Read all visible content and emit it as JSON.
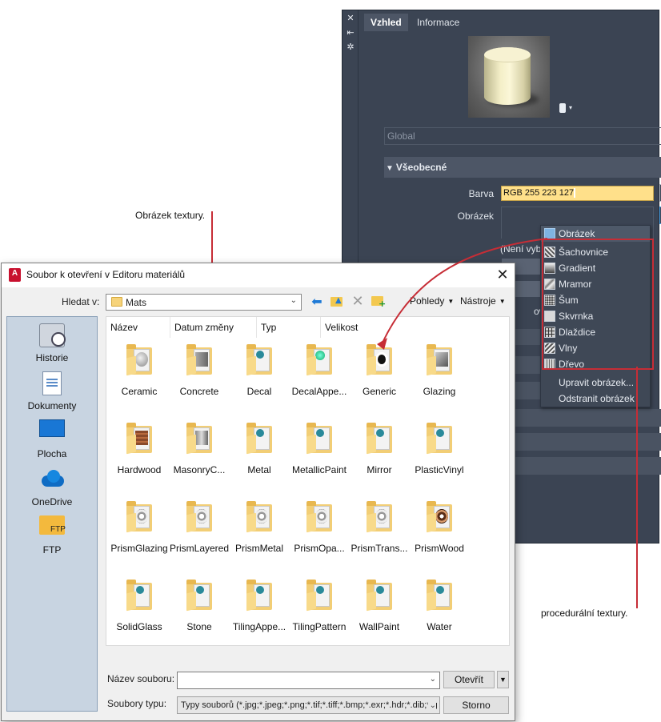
{
  "material_editor": {
    "side_icons": [
      "close-icon",
      "pin-icon",
      "settings-icon"
    ],
    "tabs": [
      {
        "label": "Vzhled",
        "active": true
      },
      {
        "label": "Informace",
        "active": false
      }
    ],
    "global_placeholder": "Global",
    "section_general": "Všeobecné",
    "color_label": "Barva",
    "color_value": "RGB 255 223 127",
    "image_label": "Obrázek",
    "not_selected": "(Není vybrán",
    "cut_text": "ový",
    "accent_colors": {
      "color_field": "#ffe08a",
      "panel_bg": "#3b4453",
      "callout": "#c62d36"
    }
  },
  "texture_menu": {
    "items": [
      {
        "label": "Obrázek",
        "icon": "image-icon"
      },
      {
        "label": "Šachovnice",
        "icon": "checker-icon"
      },
      {
        "label": "Gradient",
        "icon": "gradient-icon"
      },
      {
        "label": "Mramor",
        "icon": "marble-icon"
      },
      {
        "label": "Šum",
        "icon": "noise-icon"
      },
      {
        "label": "Skvrnka",
        "icon": "speckle-icon"
      },
      {
        "label": "Dlaždice",
        "icon": "tiles-icon"
      },
      {
        "label": "Vlny",
        "icon": "waves-icon"
      },
      {
        "label": "Dřevo",
        "icon": "wood-icon"
      }
    ],
    "edit_image": "Upravit obrázek...",
    "remove_image": "Odstranit obrázek"
  },
  "callouts": {
    "image_texture": "Obrázek textury.",
    "procedural": "procedurální textury."
  },
  "dialog": {
    "title": "Soubor k otevření v Editoru materiálů",
    "look_in_label": "Hledat v:",
    "look_in_value": "Mats",
    "views_menu": "Pohledy",
    "tools_menu": "Nástroje",
    "places": [
      {
        "label": "Historie",
        "icon": "history-icon"
      },
      {
        "label": "Dokumenty",
        "icon": "documents-icon"
      },
      {
        "label": "Plocha",
        "icon": "desktop-icon"
      },
      {
        "label": "OneDrive",
        "icon": "onedrive-icon"
      },
      {
        "label": "FTP",
        "icon": "ftp-icon",
        "icon_text": "FTP"
      }
    ],
    "columns": [
      "Název",
      "Datum změny",
      "Typ",
      "Velikost"
    ],
    "files": [
      {
        "name": "Ceramic",
        "glyph": "ceramic"
      },
      {
        "name": "Concrete",
        "glyph": "concrete"
      },
      {
        "name": "Decal",
        "glyph": "globe"
      },
      {
        "name": "DecalAppe...",
        "glyph": "decalapp"
      },
      {
        "name": "Generic",
        "glyph": "generic"
      },
      {
        "name": "Glazing",
        "glyph": "glazing"
      },
      {
        "name": "Hardwood",
        "glyph": "wood"
      },
      {
        "name": "MasonryC...",
        "glyph": "masonry"
      },
      {
        "name": "Metal",
        "glyph": "globe"
      },
      {
        "name": "MetallicPaint",
        "glyph": "globe"
      },
      {
        "name": "Mirror",
        "glyph": "globe"
      },
      {
        "name": "PlasticVinyl",
        "glyph": "globe"
      },
      {
        "name": "PrismGlazing",
        "glyph": "prism"
      },
      {
        "name": "PrismLayered",
        "glyph": "prism"
      },
      {
        "name": "PrismMetal",
        "glyph": "prism"
      },
      {
        "name": "PrismOpa...",
        "glyph": "prism"
      },
      {
        "name": "PrismTrans...",
        "glyph": "prism"
      },
      {
        "name": "PrismWood",
        "glyph": "prismwood"
      },
      {
        "name": "SolidGlass",
        "glyph": "globe"
      },
      {
        "name": "Stone",
        "glyph": "globe"
      },
      {
        "name": "TilingAppe...",
        "glyph": "globe"
      },
      {
        "name": "TilingPattern",
        "glyph": "globe"
      },
      {
        "name": "WallPaint",
        "glyph": "globe"
      },
      {
        "name": "Water",
        "glyph": "globe"
      }
    ],
    "file_name_label": "Název souboru:",
    "file_name_value": "",
    "file_type_label": "Soubory typu:",
    "file_type_value": "Typy souborů  (*.jpg;*.jpeg;*.png;*.tif;*.tiff;*.bmp;*.exr;*.hdr;*.dib;*.g",
    "open_button": "Otevřít",
    "cancel_button": "Storno"
  }
}
